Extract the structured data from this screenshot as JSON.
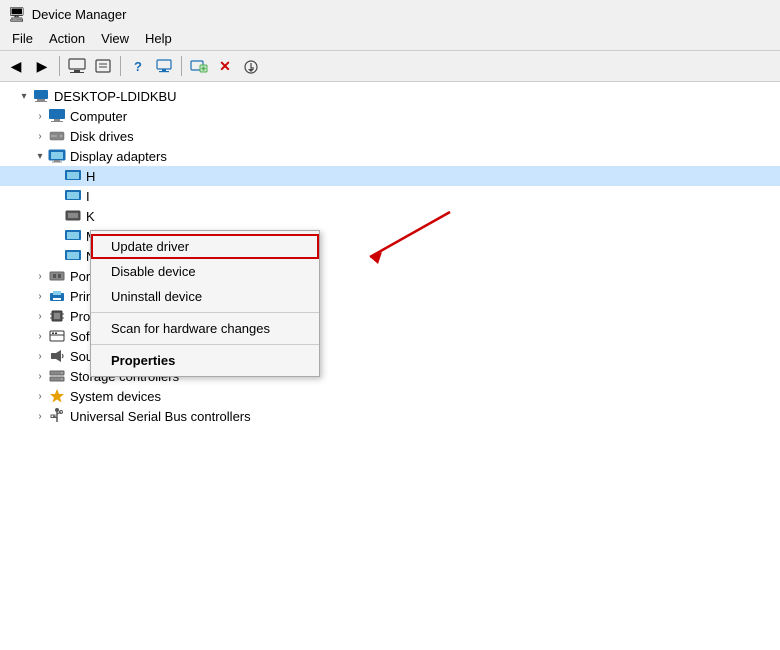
{
  "titleBar": {
    "title": "Device Manager",
    "iconLabel": "device-manager-icon"
  },
  "menuBar": {
    "items": [
      {
        "label": "File"
      },
      {
        "label": "Action"
      },
      {
        "label": "View"
      },
      {
        "label": "Help"
      }
    ]
  },
  "toolbar": {
    "buttons": [
      {
        "name": "back-button",
        "icon": "◀",
        "disabled": false
      },
      {
        "name": "forward-button",
        "icon": "▶",
        "disabled": false
      },
      {
        "name": "sep1",
        "separator": true
      },
      {
        "name": "list-button",
        "icon": "≡",
        "disabled": false
      },
      {
        "name": "detail-button",
        "icon": "⊟",
        "disabled": false
      },
      {
        "name": "sep2",
        "separator": true
      },
      {
        "name": "help-button",
        "icon": "❓",
        "disabled": false
      },
      {
        "name": "grid-button",
        "icon": "▦",
        "disabled": false
      },
      {
        "name": "sep3",
        "separator": true
      },
      {
        "name": "monitor-button",
        "icon": "🖥",
        "disabled": false
      },
      {
        "name": "sep4",
        "separator": true
      },
      {
        "name": "add-button",
        "icon": "🖨",
        "disabled": false
      },
      {
        "name": "remove-button",
        "icon": "✖",
        "disabled": false,
        "color": "red"
      },
      {
        "name": "update-button",
        "icon": "⬇",
        "disabled": false
      }
    ]
  },
  "tree": {
    "rootLabel": "DESKTOP-LDIDKBU",
    "items": [
      {
        "label": "Computer",
        "indent": 1,
        "expanded": false,
        "icon": "🖥",
        "iconClass": "icon-computer"
      },
      {
        "label": "Disk drives",
        "indent": 1,
        "expanded": false,
        "icon": "💾",
        "iconClass": "icon-disk"
      },
      {
        "label": "Display adapters",
        "indent": 1,
        "expanded": true,
        "icon": "🖥",
        "iconClass": "icon-display"
      },
      {
        "label": "H",
        "indent": 2,
        "expanded": false,
        "icon": "🖥",
        "iconClass": "icon-hid",
        "hasContextMenu": true
      },
      {
        "label": "I",
        "indent": 2,
        "expanded": false,
        "icon": "🖥",
        "iconClass": "icon-display"
      },
      {
        "label": "K",
        "indent": 2,
        "expanded": false,
        "icon": "🖥",
        "iconClass": "icon-display"
      },
      {
        "label": "M",
        "indent": 2,
        "expanded": false,
        "icon": "🖥",
        "iconClass": "icon-monitor"
      },
      {
        "label": "N",
        "indent": 2,
        "expanded": false,
        "icon": "🖥",
        "iconClass": "icon-display"
      },
      {
        "label": "Ports (COM & LPT)",
        "indent": 1,
        "expanded": false,
        "icon": "⬛",
        "iconClass": "icon-ports"
      },
      {
        "label": "Print queues",
        "indent": 1,
        "expanded": false,
        "icon": "🖨",
        "iconClass": "icon-print"
      },
      {
        "label": "Processors",
        "indent": 1,
        "expanded": false,
        "icon": "⬛",
        "iconClass": "icon-processor"
      },
      {
        "label": "Software devices",
        "indent": 1,
        "expanded": false,
        "icon": "⬛",
        "iconClass": "icon-software"
      },
      {
        "label": "Sound, video and game controllers",
        "indent": 1,
        "expanded": false,
        "icon": "🔊",
        "iconClass": "icon-sound"
      },
      {
        "label": "Storage controllers",
        "indent": 1,
        "expanded": false,
        "icon": "💾",
        "iconClass": "icon-storage"
      },
      {
        "label": "System devices",
        "indent": 1,
        "expanded": false,
        "icon": "⭐",
        "iconClass": "icon-system"
      },
      {
        "label": "Universal Serial Bus controllers",
        "indent": 1,
        "expanded": false,
        "icon": "🔌",
        "iconClass": "icon-usb"
      }
    ]
  },
  "contextMenu": {
    "items": [
      {
        "label": "Update driver",
        "highlighted": true
      },
      {
        "label": "Disable device"
      },
      {
        "label": "Uninstall device"
      },
      {
        "separator": true
      },
      {
        "label": "Scan for hardware changes"
      },
      {
        "separator": true
      },
      {
        "label": "Properties",
        "bold": true
      }
    ]
  }
}
